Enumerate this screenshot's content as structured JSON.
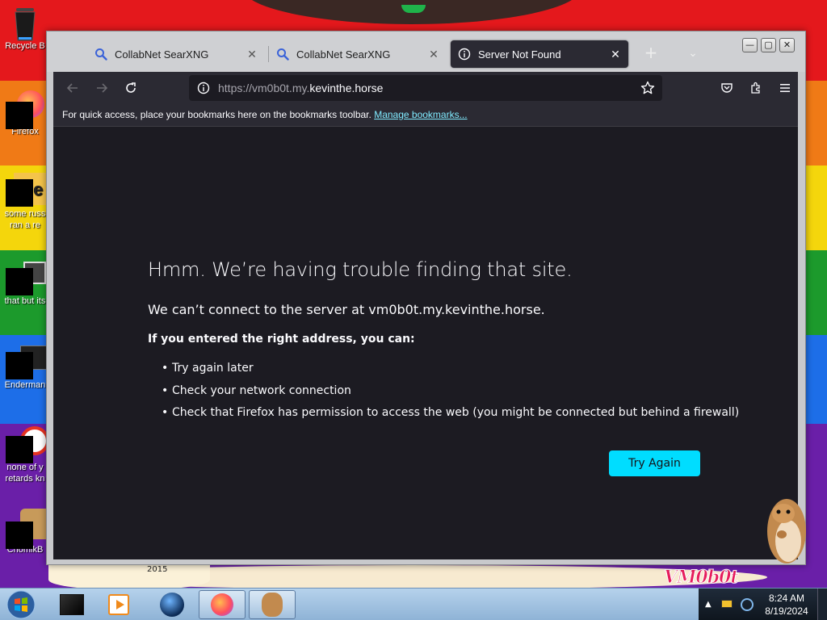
{
  "desktop": {
    "icons": [
      {
        "label": "Recycle B",
        "label2": ""
      },
      {
        "label": "Firefox",
        "label2": ""
      },
      {
        "label": "some russ",
        "label2": "ran a re"
      },
      {
        "label": "that but its",
        "label2": ""
      },
      {
        "label": "Enderman",
        "label2": ""
      },
      {
        "label": "none of y",
        "label2": "retards kn"
      },
      {
        "label": "ChomikB",
        "label2": ""
      }
    ],
    "wallpaper_text": "VM0b0t",
    "year_label": "2015"
  },
  "browser": {
    "tabs": [
      {
        "label": "CollabNet SearXNG",
        "icon": "search-icon",
        "active": false
      },
      {
        "label": "CollabNet SearXNG",
        "icon": "search-icon",
        "active": false
      },
      {
        "label": "Server Not Found",
        "icon": "info-icon",
        "active": true
      }
    ],
    "url": {
      "prefix": "https://vm0b0t.my.",
      "domain": "kevinthe.horse"
    },
    "bookmarks_bar": {
      "message": "For quick access, place your bookmarks here on the bookmarks toolbar.",
      "link": "Manage bookmarks..."
    },
    "error_page": {
      "title": "Hmm. We’re having trouble finding that site.",
      "description": "We can’t connect to the server at vm0b0t.my.kevinthe.horse.",
      "hint": "If you entered the right address, you can:",
      "suggestions": [
        "Try again later",
        "Check your network connection",
        "Check that Firefox has permission to access the web (you might be connected but behind a firewall)"
      ],
      "button_label": "Try Again"
    },
    "accent_color": "#00ddff"
  },
  "taskbar": {
    "clock_time": "8:24 AM",
    "clock_date": "8/19/2024"
  }
}
